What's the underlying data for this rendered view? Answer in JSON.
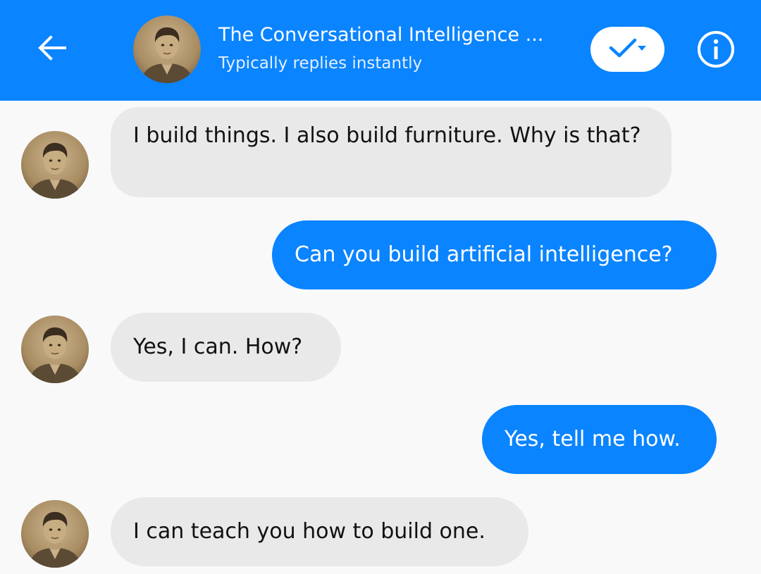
{
  "header": {
    "back_icon": "arrow-left-icon",
    "avatar_icon": "profile-photo",
    "title": "The Conversational Intelligence ...",
    "subtitle": "Typically replies instantly",
    "check_icon": "checkmark-dropdown-icon",
    "info_icon": "info-icon"
  },
  "colors": {
    "accent": "#0a84ff",
    "incoming_bubble": "#e9e9e9",
    "background": "#f9f9f9"
  },
  "messages": [
    {
      "sender": "bot",
      "text": "I build things. I also build furniture. Why is that?"
    },
    {
      "sender": "user",
      "text": "Can you build artificial intelligence?"
    },
    {
      "sender": "bot",
      "text": "Yes, I can. How?"
    },
    {
      "sender": "user",
      "text": "Yes, tell me how."
    },
    {
      "sender": "bot",
      "text": "I can teach you how to build one."
    }
  ]
}
